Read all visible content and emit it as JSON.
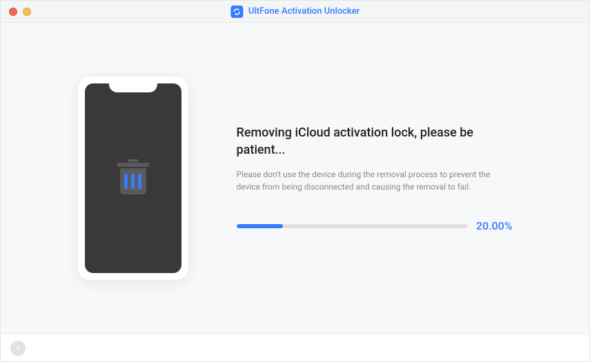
{
  "titlebar": {
    "app_title": "UltFone Activation Unlocker"
  },
  "main": {
    "heading": "Removing iCloud activation lock, please be patient...",
    "subtext": "Please don't use the device during the removal process to prevent the device from being disconnected and causing the removal to fail.",
    "progress_percent": 20,
    "progress_label": "20.00%"
  },
  "colors": {
    "accent": "#377bff"
  }
}
